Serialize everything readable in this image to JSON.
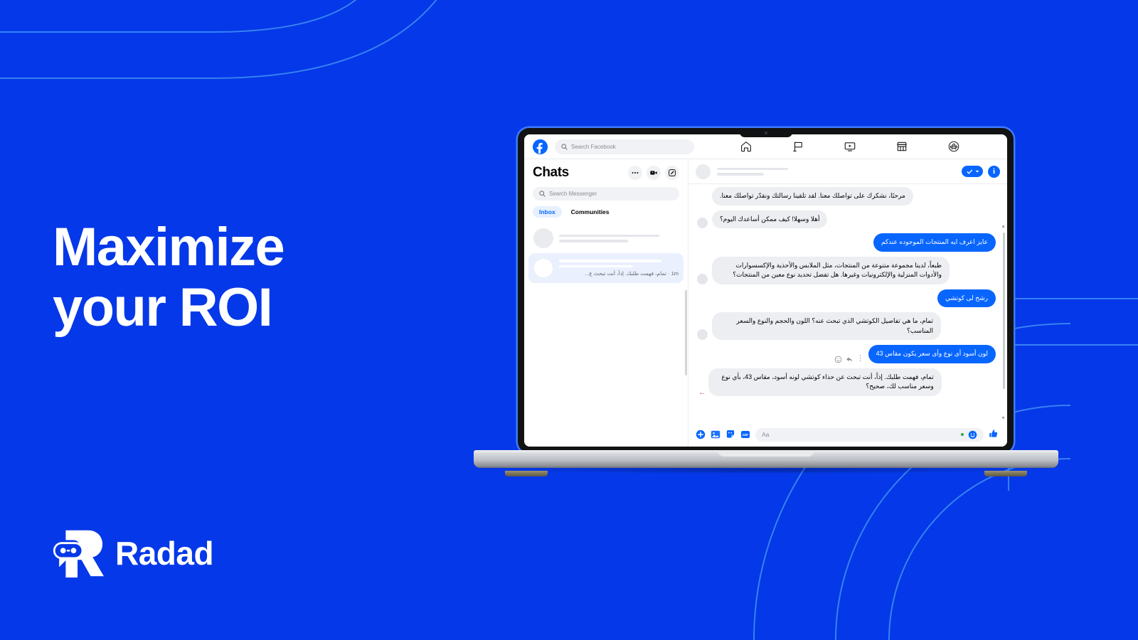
{
  "brand": {
    "name": "Radad",
    "logo_icon": "radad-robot-r-logo",
    "background_color": "#0538E8",
    "accent_color": "#0866FF"
  },
  "hero": {
    "headline_line1": "Maximize",
    "headline_line2": "your ROI"
  },
  "facebook": {
    "logo_icon": "facebook-logo-icon",
    "search": {
      "icon": "search-icon",
      "placeholder": "Search Facebook",
      "value": ""
    },
    "nav": [
      {
        "name": "home",
        "icon": "home-icon"
      },
      {
        "name": "marketplace-flag",
        "icon": "flag-icon"
      },
      {
        "name": "watch",
        "icon": "video-play-icon"
      },
      {
        "name": "shop",
        "icon": "store-icon"
      },
      {
        "name": "groups",
        "icon": "groups-icon"
      }
    ]
  },
  "messenger": {
    "sidebar": {
      "title": "Chats",
      "actions": [
        {
          "name": "more-options",
          "icon": "ellipsis-icon",
          "label": "•••"
        },
        {
          "name": "new-video-room",
          "icon": "video-camera-icon"
        },
        {
          "name": "new-message",
          "icon": "compose-pencil-icon"
        }
      ],
      "search": {
        "icon": "search-icon",
        "placeholder": "Search Messenger",
        "value": ""
      },
      "tabs": [
        {
          "label": "Inbox",
          "active": true
        },
        {
          "label": "Communities",
          "active": false
        }
      ],
      "conversations": [
        {
          "name_redacted": true,
          "snippet": "",
          "time": "",
          "selected": false,
          "placeholder": true
        },
        {
          "name_redacted": true,
          "snippet": "تمام، فهمت طلبك. إذاً، أنت تبحث ع...",
          "time": "1m",
          "separator": "·",
          "selected": true,
          "placeholder": false
        }
      ]
    },
    "thread": {
      "header": {
        "avatar": "contact-avatar",
        "name_redacted": true,
        "status_redacted": true,
        "verified_pill_icon": "check-chevron-icon",
        "info_icon": "info-circle-icon"
      },
      "messages": [
        {
          "from": "them",
          "text": "مرحبًا، نشكرك على تواصلك معنا. لقد تلقينا رسالتك ونقدّر تواصلك معنا.",
          "avatar": false
        },
        {
          "from": "them",
          "text": "أهلا وسهلا! كيف ممكن أساعدك اليوم؟",
          "avatar": true
        },
        {
          "from": "me",
          "text": "عايز اعرف ايه المنتجات الموجوده عندكم",
          "avatar": false
        },
        {
          "from": "them",
          "text": "طبعاً، لدينا مجموعة متنوعة من المنتجات، مثل الملابس والأحذية والإكسسوارات والأدوات المنزلية والإلكترونيات وغيرها. هل تفضل تحديد نوع معين من المنتجات؟",
          "avatar": true
        },
        {
          "from": "me",
          "text": "رشح لى كوتشي",
          "avatar": false
        },
        {
          "from": "them",
          "text": "تمام، ما هي تفاصيل الكوتشي الذي تبحث عنه؟ اللون والحجم والنوع والسعر المناسب؟",
          "avatar": true
        },
        {
          "from": "me",
          "text": "لون أسود أى نوع وأى سعر يكون مقاس 43",
          "avatar": false,
          "hover_actions": [
            "more-menu-icon",
            "reply-icon",
            "react-emoji-icon"
          ]
        },
        {
          "from": "them",
          "text": "تمام، فهمت طلبك. إذاً، أنت تبحث عن حذاء كوتشي لونه أسود، مقاس 43، بأي نوع وسعر مناسب لك، صحيح؟",
          "avatar": false,
          "seen_marker": "•—"
        }
      ],
      "composer": {
        "actions": [
          {
            "name": "add-attachment",
            "icon": "plus-circle-icon"
          },
          {
            "name": "attach-photo",
            "icon": "photo-icon"
          },
          {
            "name": "attach-sticker",
            "icon": "sticker-icon"
          },
          {
            "name": "attach-gif",
            "icon": "gif-icon"
          }
        ],
        "input_placeholder": "Aa",
        "input_value": "",
        "emoji_icon": "emoji-smiley-icon",
        "like_icon": "thumbs-up-icon"
      }
    }
  }
}
